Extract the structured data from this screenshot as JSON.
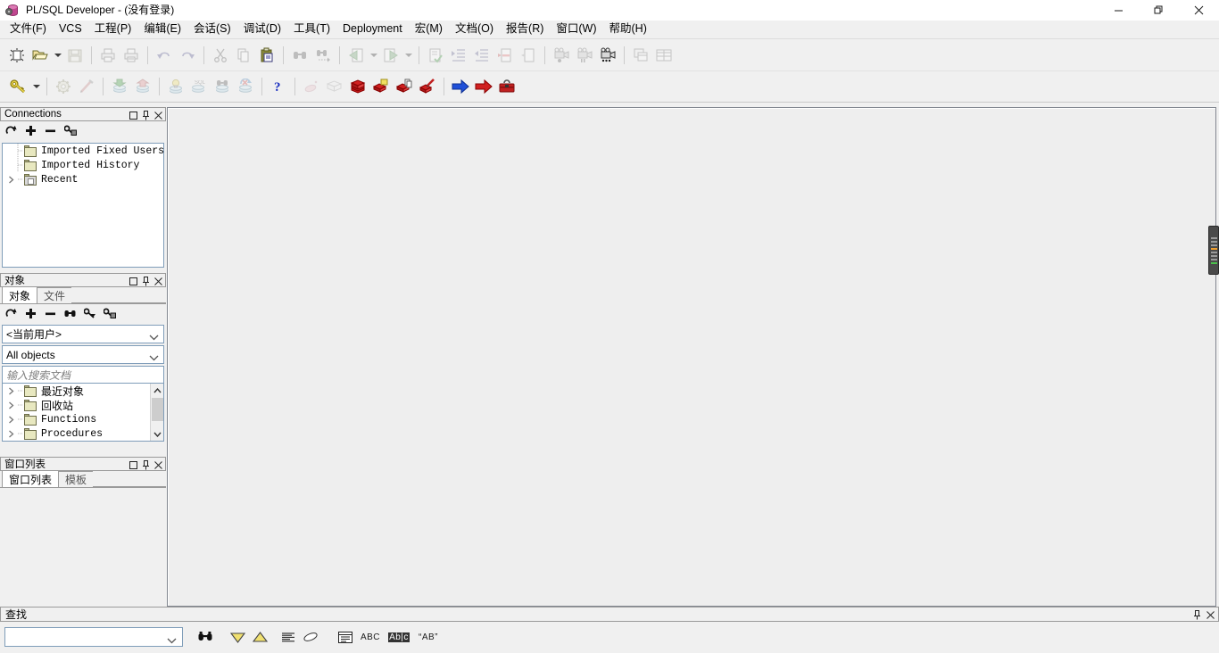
{
  "window": {
    "title": "PL/SQL Developer - (没有登录)",
    "app_icon": "database-gear-icon",
    "minimize_label": "—",
    "restore_label": "❐",
    "close_label": "✕"
  },
  "menubar": {
    "items": [
      {
        "label": "文件(F)",
        "name": "menu-file"
      },
      {
        "label": "VCS",
        "name": "menu-vcs"
      },
      {
        "label": "工程(P)",
        "name": "menu-project"
      },
      {
        "label": "编辑(E)",
        "name": "menu-edit"
      },
      {
        "label": "会话(S)",
        "name": "menu-session"
      },
      {
        "label": "调试(D)",
        "name": "menu-debug"
      },
      {
        "label": "工具(T)",
        "name": "menu-tools"
      },
      {
        "label": "Deployment",
        "name": "menu-deployment"
      },
      {
        "label": "宏(M)",
        "name": "menu-macro"
      },
      {
        "label": "文档(O)",
        "name": "menu-document"
      },
      {
        "label": "报告(R)",
        "name": "menu-report"
      },
      {
        "label": "窗口(W)",
        "name": "menu-window"
      },
      {
        "label": "帮助(H)",
        "name": "menu-help"
      }
    ]
  },
  "toolbar_main": {
    "icons": [
      "new-file-icon",
      "open-folder-icon",
      "save-icon",
      "print-icon",
      "print-preview-icon",
      "undo-icon",
      "redo-icon",
      "cut-icon",
      "copy-icon",
      "paste-icon",
      "find-icon",
      "find-next-icon",
      "previous-icon",
      "next-icon",
      "execute-check-icon",
      "indent-icon",
      "outdent-icon",
      "comment-icon",
      "uncomment-icon",
      "record-macro-icon",
      "pause-macro-icon",
      "play-macro-icon",
      "cascade-windows-icon",
      "tile-windows-icon"
    ]
  },
  "toolbar_session": {
    "icons": [
      "key-login-icon",
      "gear-icon",
      "pen-icon",
      "import-db-icon",
      "export-db-icon",
      "db-bulb-icon",
      "db-sql-icon",
      "db-find-icon",
      "db-refresh-icon",
      "help-question-icon",
      "eraser-pink-icon",
      "book-outline-icon",
      "red-books-icon",
      "book-new-icon",
      "book-copy-icon",
      "book-edit-icon",
      "blue-arrow-icon",
      "red-arrow-icon",
      "toolbox-icon"
    ]
  },
  "connections_panel": {
    "title": "Connections",
    "controls": [
      "maximize-icon",
      "pin-icon",
      "close-icon"
    ],
    "toolbar_icons": [
      "refresh-icon",
      "add-icon",
      "remove-icon",
      "key-lock-icon"
    ],
    "tree": [
      {
        "label": "Imported Fixed Users",
        "expandable": false,
        "icon": "folder-icon"
      },
      {
        "label": "Imported History",
        "expandable": false,
        "icon": "folder-icon"
      },
      {
        "label": "Recent",
        "expandable": true,
        "icon": "folder-recent-icon"
      }
    ]
  },
  "objects_panel": {
    "title": "对象",
    "controls": [
      "maximize-icon",
      "pin-icon",
      "close-icon"
    ],
    "tabs": [
      {
        "label": "对象",
        "active": true
      },
      {
        "label": "文件",
        "active": false
      }
    ],
    "toolbar_icons": [
      "refresh-icon",
      "add-icon",
      "remove-icon",
      "find-icon",
      "filter-key-icon",
      "key-lock-icon"
    ],
    "user_select": {
      "value": "<当前用户>"
    },
    "type_select": {
      "value": "All objects"
    },
    "search": {
      "placeholder": "输入搜索文档",
      "value": ""
    },
    "tree": [
      {
        "label": "最近对象",
        "cjk": true
      },
      {
        "label": "回收站",
        "cjk": true
      },
      {
        "label": "Functions",
        "cjk": false
      },
      {
        "label": "Procedures",
        "cjk": false
      }
    ]
  },
  "windowlist_panel": {
    "title": "窗口列表",
    "controls": [
      "maximize-icon",
      "pin-icon",
      "close-icon"
    ],
    "tabs": [
      {
        "label": "窗口列表",
        "active": true
      },
      {
        "label": "模板",
        "active": false
      }
    ],
    "items": []
  },
  "find_bar": {
    "title": "查找",
    "controls": [
      "pin-icon",
      "close-icon"
    ],
    "input": {
      "value": "",
      "placeholder": ""
    },
    "buttons": [
      {
        "name": "find-button",
        "icon": "binoculars-icon",
        "label": ""
      },
      {
        "name": "find-down-button",
        "icon": "triangle-down-icon",
        "label": ""
      },
      {
        "name": "find-up-button",
        "icon": "triangle-up-icon",
        "label": ""
      },
      {
        "name": "find-list-button",
        "icon": "list-lines-icon",
        "label": ""
      },
      {
        "name": "clear-button",
        "icon": "eraser-icon",
        "label": ""
      },
      {
        "name": "find-in-window-button",
        "icon": "window-find-icon",
        "label": ""
      },
      {
        "name": "match-case-button",
        "icon": "abc-icon",
        "label": "ABC"
      },
      {
        "name": "match-word-button",
        "icon": "highlight-abc-icon",
        "label": "Ab|c"
      },
      {
        "name": "regex-button",
        "icon": "quoted-ab-icon",
        "label": "“AB”"
      }
    ]
  },
  "mdi_area": {
    "background": "#eeeeee",
    "handle": "edge-resize-handle"
  },
  "colors": {
    "chrome": "#f0f0f0",
    "panel_border": "#9a9a9a",
    "field_border": "#7f9db9",
    "mdi_bg": "#eeeeee",
    "accent_blue": "#1a3fd0",
    "accent_red": "#cc2222"
  }
}
